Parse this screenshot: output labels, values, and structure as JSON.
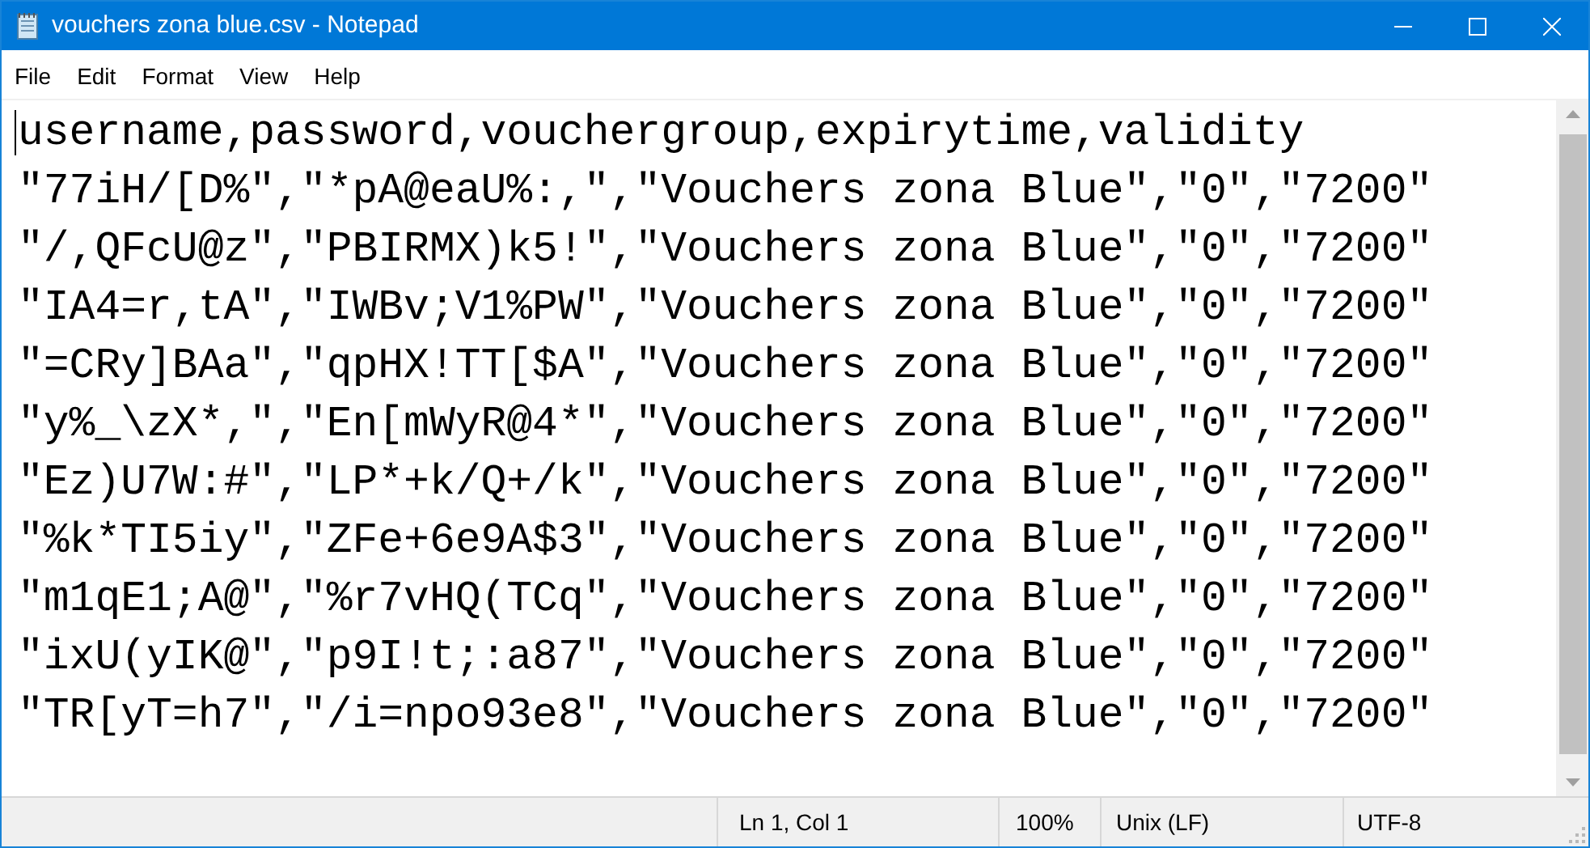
{
  "window": {
    "title": "vouchers zona blue.csv - Notepad"
  },
  "menu": [
    "File",
    "Edit",
    "Format",
    "View",
    "Help"
  ],
  "editor": {
    "lines": [
      "username,password,vouchergroup,expirytime,validity",
      "\"77iH/[D%\",\"*pA@eaU%:,\",\"Vouchers zona Blue\",\"0\",\"7200\"",
      "\"/,QFcU@z\",\"PBIRMX)k5!\",\"Vouchers zona Blue\",\"0\",\"7200\"",
      "\"IA4=r,tA\",\"IWBv;V1%PW\",\"Vouchers zona Blue\",\"0\",\"7200\"",
      "\"=CRy]BAa\",\"qpHX!TT[$A\",\"Vouchers zona Blue\",\"0\",\"7200\"",
      "\"y%_\\zX*,\",\"En[mWyR@4*\",\"Vouchers zona Blue\",\"0\",\"7200\"",
      "\"Ez)U7W:#\",\"LP*+k/Q+/k\",\"Vouchers zona Blue\",\"0\",\"7200\"",
      "\"%k*TI5iy\",\"ZFe+6e9A$3\",\"Vouchers zona Blue\",\"0\",\"7200\"",
      "\"m1qE1;A@\",\"%r7vHQ(TCq\",\"Vouchers zona Blue\",\"0\",\"7200\"",
      "\"ixU(yIK@\",\"p9I!t;:a87\",\"Vouchers zona Blue\",\"0\",\"7200\"",
      "\"TR[yT=h7\",\"/i=npo93e8\",\"Vouchers zona Blue\",\"0\",\"7200\""
    ]
  },
  "status_bar": {
    "position": "Ln 1, Col 1",
    "zoom": "100%",
    "line_ending": "Unix (LF)",
    "encoding": "UTF-8"
  }
}
